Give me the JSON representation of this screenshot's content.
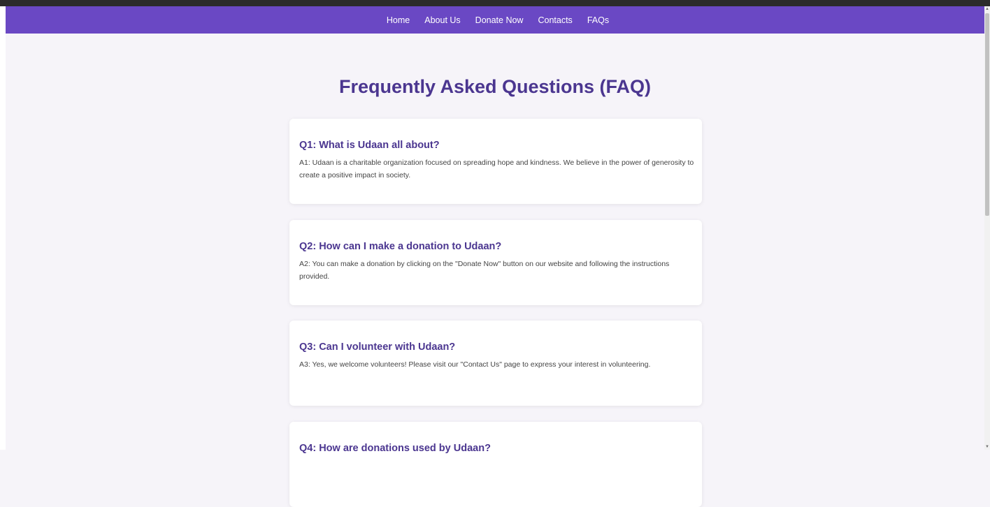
{
  "nav": {
    "items": [
      {
        "label": "Home"
      },
      {
        "label": "About Us"
      },
      {
        "label": "Donate Now"
      },
      {
        "label": "Contacts"
      },
      {
        "label": "FAQs"
      }
    ]
  },
  "page": {
    "title": "Frequently Asked Questions (FAQ)"
  },
  "faqs": [
    {
      "question": "Q1: What is Udaan all about?",
      "answer": "A1: Udaan is a charitable organization focused on spreading hope and kindness. We believe in the power of generosity to create a positive impact in society."
    },
    {
      "question": "Q2: How can I make a donation to Udaan?",
      "answer": "A2: You can make a donation by clicking on the \"Donate Now\" button on our website and following the instructions provided."
    },
    {
      "question": "Q3: Can I volunteer with Udaan?",
      "answer": "A3: Yes, we welcome volunteers! Please visit our \"Contact Us\" page to express your interest in volunteering."
    },
    {
      "question": "Q4: How are donations used by Udaan?",
      "answer": ""
    }
  ],
  "colors": {
    "navbar": "#6a48c4",
    "accent": "#4b3690",
    "background": "#f6f4f9",
    "card": "#ffffff"
  }
}
